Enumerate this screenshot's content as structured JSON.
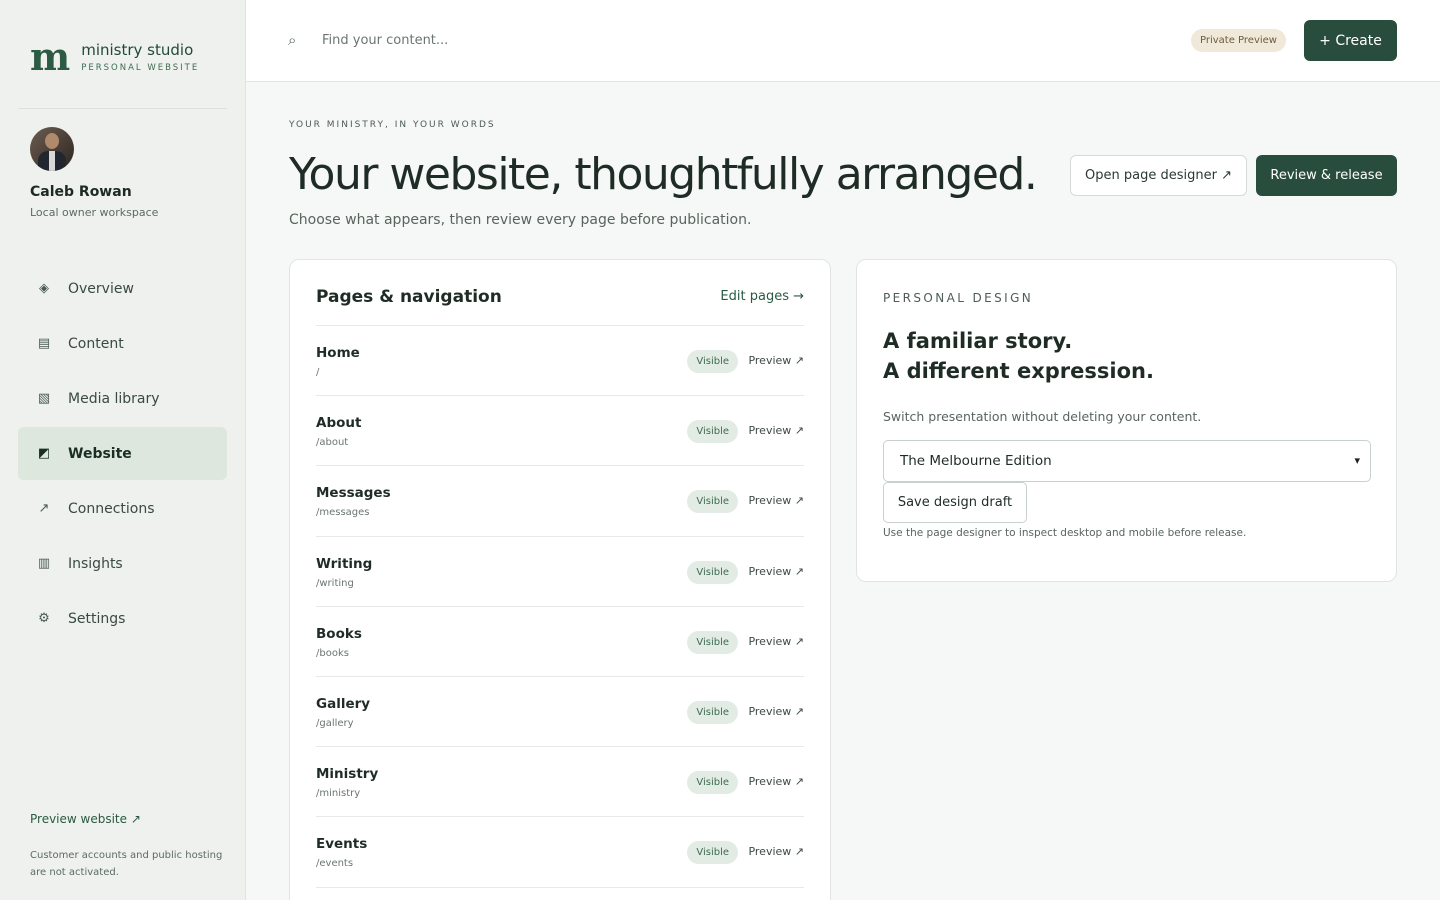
{
  "brand": {
    "logo": "m",
    "name": "ministry studio",
    "subtitle": "PERSONAL WEBSITE"
  },
  "user": {
    "name": "Caleb Rowan",
    "role": "Local owner workspace"
  },
  "sidebar": {
    "items": [
      {
        "label": "Overview",
        "icon": "diamond-icon",
        "glyph": "◈"
      },
      {
        "label": "Content",
        "icon": "document-icon",
        "glyph": "▤"
      },
      {
        "label": "Media library",
        "icon": "image-icon",
        "glyph": "▧"
      },
      {
        "label": "Website",
        "icon": "website-icon",
        "glyph": "◩"
      },
      {
        "label": "Connections",
        "icon": "arrow-up-right-icon",
        "glyph": "↗"
      },
      {
        "label": "Insights",
        "icon": "columns-icon",
        "glyph": "▥"
      },
      {
        "label": "Settings",
        "icon": "gear-icon",
        "glyph": "⚙"
      }
    ],
    "active": "Website",
    "preview_link": "Preview website ↗",
    "footnote": "Customer accounts and public hosting are not activated."
  },
  "topbar": {
    "search_placeholder": "Find your content...",
    "search_icon": "⌕",
    "badge": "Private Preview",
    "create_label": "+ Create"
  },
  "header": {
    "eyebrow": "YOUR MINISTRY, IN YOUR WORDS",
    "title": "Your website, thoughtfully arranged.",
    "subtitle": "Choose what appears, then review every page before publication.",
    "designer_label": "Open page designer ↗",
    "release_label": "Review & release"
  },
  "pages_card": {
    "title": "Pages & navigation",
    "edit_label": "Edit pages →",
    "rows": [
      {
        "name": "Home",
        "path": "/",
        "status": "Visible",
        "preview": "Preview ↗"
      },
      {
        "name": "About",
        "path": "/about",
        "status": "Visible",
        "preview": "Preview ↗"
      },
      {
        "name": "Messages",
        "path": "/messages",
        "status": "Visible",
        "preview": "Preview ↗"
      },
      {
        "name": "Writing",
        "path": "/writing",
        "status": "Visible",
        "preview": "Preview ↗"
      },
      {
        "name": "Books",
        "path": "/books",
        "status": "Visible",
        "preview": "Preview ↗"
      },
      {
        "name": "Gallery",
        "path": "/gallery",
        "status": "Visible",
        "preview": "Preview ↗"
      },
      {
        "name": "Ministry",
        "path": "/ministry",
        "status": "Visible",
        "preview": "Preview ↗"
      },
      {
        "name": "Events",
        "path": "/events",
        "status": "Visible",
        "preview": "Preview ↗"
      }
    ]
  },
  "design_card": {
    "eyebrow": "PERSONAL DESIGN",
    "heading_line1": "A familiar story.",
    "heading_line2": "A different expression.",
    "subtitle": "Switch presentation without deleting your content.",
    "selected_design": "The Melbourne Edition",
    "save_label": "Save design draft",
    "note": "Use the page designer to inspect desktop and mobile before release."
  },
  "colors": {
    "accent": "#294d3c",
    "sidebar_bg": "#eef1ed",
    "active_nav": "#dde7de",
    "badge_visible": "#e3ece4",
    "badge_preview": "#f0e8d8"
  }
}
